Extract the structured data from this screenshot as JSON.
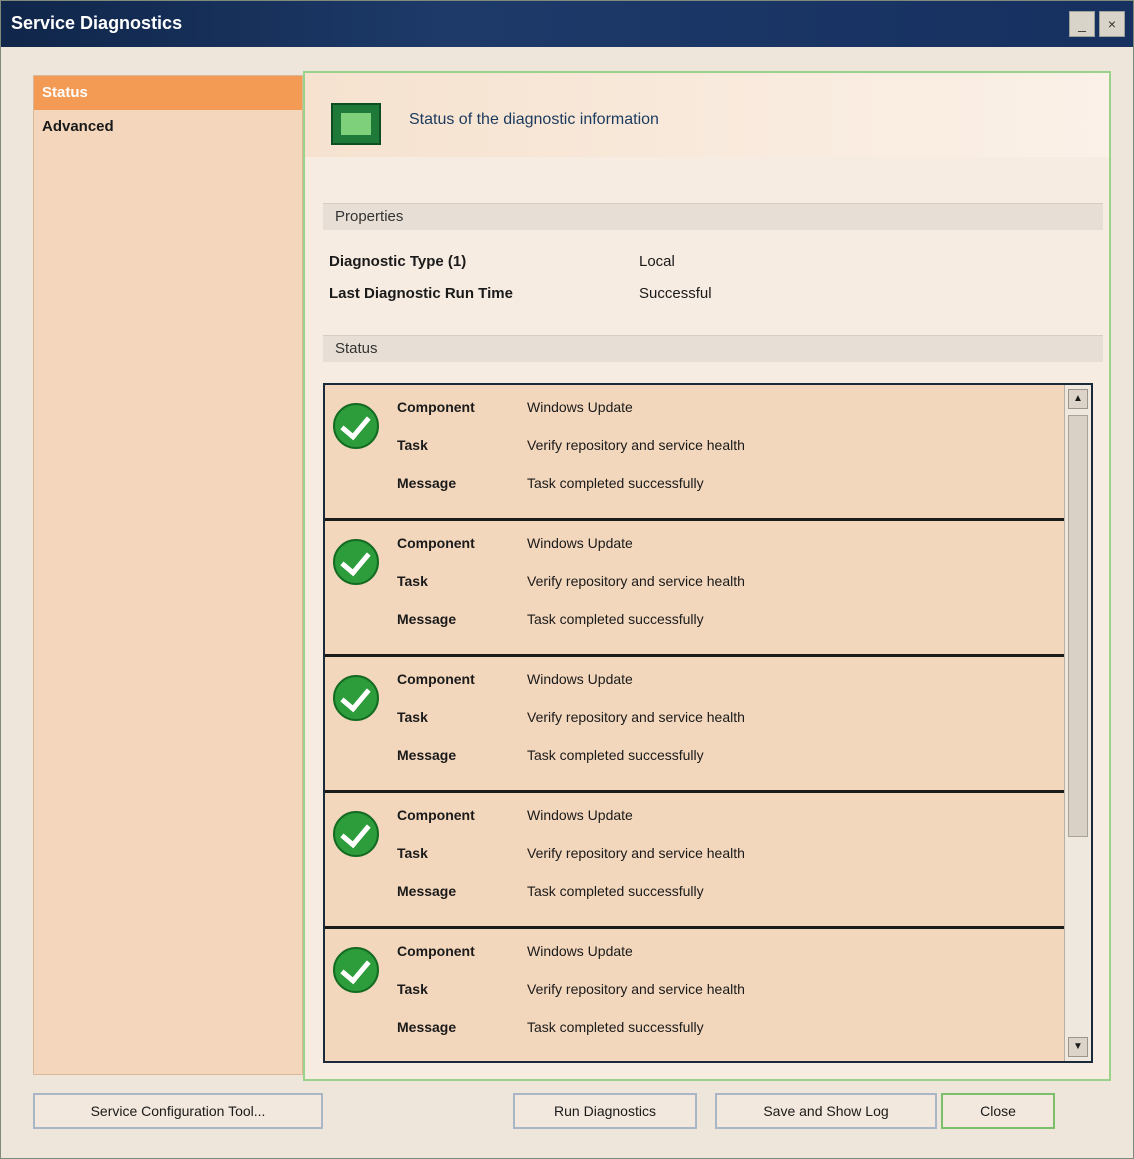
{
  "window": {
    "title": "Service Diagnostics",
    "minimize_glyph": "_",
    "close_glyph": "×"
  },
  "sidebar": {
    "items": [
      {
        "label": "Status"
      },
      {
        "label": "Advanced"
      }
    ]
  },
  "header": {
    "text": "Status of the diagnostic information"
  },
  "properties": {
    "section_label": "Properties",
    "rows": [
      {
        "key": "Diagnostic Type (1)",
        "value": "Local"
      },
      {
        "key": "Last Diagnostic Run Time",
        "value": "Successful"
      }
    ]
  },
  "status": {
    "section_label": "Status",
    "entries": [
      {
        "k1": "Component",
        "v1": "Windows Update",
        "k2": "Task",
        "v2": "Verify repository and service health",
        "k3": "Message",
        "v3": "Task completed successfully"
      },
      {
        "k1": "Component",
        "v1": "Windows Update",
        "k2": "Task",
        "v2": "Verify repository and service health",
        "k3": "Message",
        "v3": "Task completed successfully"
      },
      {
        "k1": "Component",
        "v1": "Windows Update",
        "k2": "Task",
        "v2": "Verify repository and service health",
        "k3": "Message",
        "v3": "Task completed successfully"
      },
      {
        "k1": "Component",
        "v1": "Windows Update",
        "k2": "Task",
        "v2": "Verify repository and service health",
        "k3": "Message",
        "v3": "Task completed successfully"
      },
      {
        "k1": "Component",
        "v1": "Windows Update",
        "k2": "Task",
        "v2": "Verify repository and service health",
        "k3": "Message",
        "v3": "Task completed successfully"
      }
    ],
    "scroll_up_glyph": "▲",
    "scroll_down_glyph": "▼"
  },
  "buttons": {
    "service_config": "Service Configuration Tool...",
    "run_diagnostics": "Run Diagnostics",
    "save_to_file": "Save and Show Log",
    "close": "Close"
  }
}
